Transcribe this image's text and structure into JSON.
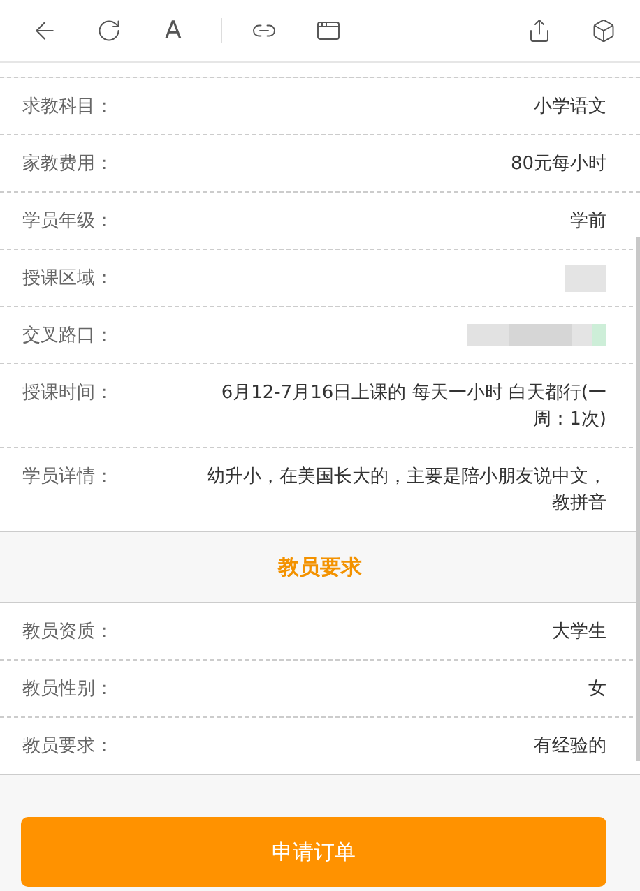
{
  "toolbar": {
    "font_button": "A"
  },
  "student_rows": [
    {
      "label": "求教科目：",
      "value": "小学语文",
      "kind": "text"
    },
    {
      "label": "家教费用：",
      "value": "80元每小时",
      "kind": "text"
    },
    {
      "label": "学员年级：",
      "value": "学前",
      "kind": "text"
    },
    {
      "label": "授课区域：",
      "kind": "redacted"
    },
    {
      "label": "交叉路口：",
      "kind": "redacted"
    },
    {
      "label": "授课时间：",
      "value": "6月12-7月16日上课的 每天一小时 白天都行(一周：1次)",
      "kind": "text"
    },
    {
      "label": "学员详情：",
      "value": "幼升小，在美国长大的，主要是陪小朋友说中文，教拼音",
      "kind": "text"
    }
  ],
  "section_title": "教员要求",
  "teacher_rows": [
    {
      "label": "教员资质：",
      "value": "大学生",
      "kind": "text"
    },
    {
      "label": "教员性别：",
      "value": "女",
      "kind": "text"
    },
    {
      "label": "教员要求：",
      "value": "有经验的",
      "kind": "text"
    }
  ],
  "submit_button": "申请订单"
}
